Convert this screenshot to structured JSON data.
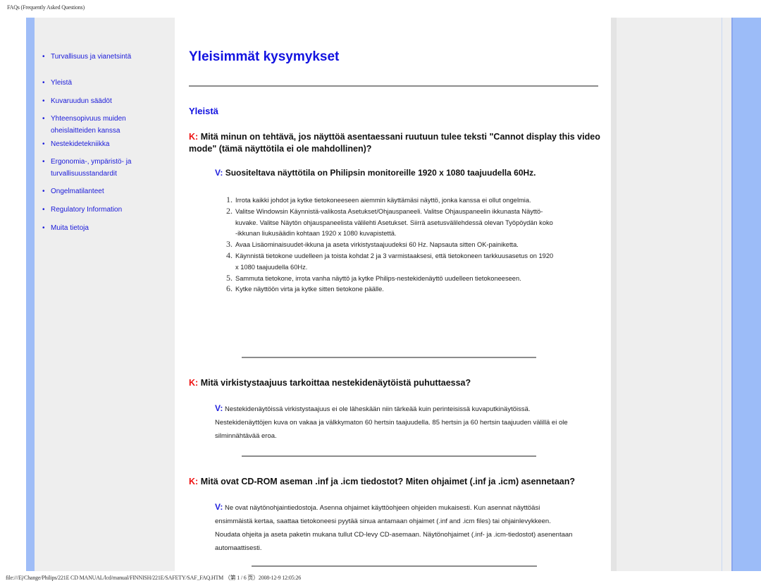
{
  "page_header": "FAQs (Frequently Asked Questions)",
  "page_footer": "file:///E|/Change/Philips/221E CD MANUAL/lcd/manual/FINNISH/221E/SAFETY/SAF_FAQ.HTM （第 1 / 6 页）2008-12-9 12:05:26",
  "sidebar": {
    "items": [
      {
        "label": "Turvallisuus ja vianetsintä"
      },
      {
        "label": "Yleistä"
      },
      {
        "label": "Kuvaruudun säädöt"
      },
      {
        "label": "Yhteensopivuus muiden oheislaitteiden kanssa"
      },
      {
        "label": "Nestekidetekniikka"
      },
      {
        "label": "Ergonomia-, ympäristö- ja turvallisuusstandardit"
      },
      {
        "label": "Ongelmatilanteet"
      },
      {
        "label": "Regulatory Information"
      },
      {
        "label": "Muita tietoja"
      }
    ],
    "bullet": "•"
  },
  "main": {
    "title": "Yleisimmät kysymykset",
    "section_title": "Yleistä",
    "q_prefix": "K:",
    "a_prefix": "V:",
    "faqs": [
      {
        "question": "Mitä minun on tehtävä, jos näyttöä asentaessani ruutuun tulee teksti \"Cannot display this video mode\" (tämä näyttötila ei ole mahdollinen)?",
        "answer_lead": "Suositeltava näyttötila on Philipsin monitoreille 1920 x 1080 taajuudella 60Hz.",
        "steps": [
          {
            "num": "1.",
            "text": "Irrota kaikki johdot ja kytke tietokoneeseen aiemmin käyttämäsi näyttö, jonka kanssa ei ollut ongelmia."
          },
          {
            "num": "2.",
            "text": "Valitse Windowsin Käynnistä-valikosta Asetukset/Ohjauspaneeli. Valitse Ohjauspaneelin ikkunasta Näyttö-kuvake. Valitse Näytön ohjauspaneelista välilehti Asetukset. Siirrä asetusvälilehdessä olevan Työpöydän koko -ikkunan liukusäädin kohtaan 1920 x 1080 kuvapistettä."
          },
          {
            "num": "3.",
            "text": "Avaa Lisäominaisuudet-ikkuna ja aseta virkistystaajuudeksi 60 Hz. Napsauta sitten OK-painiketta."
          },
          {
            "num": "4.",
            "text": "Käynnistä tietokone uudelleen ja toista kohdat 2 ja 3 varmistaaksesi, että tietokoneen tarkkuusasetus on 1920 x 1080 taajuudella 60Hz."
          },
          {
            "num": "5.",
            "text": "Sammuta tietokone, irrota vanha näyttö ja kytke Philips-nestekidenäyttö uudelleen tietokoneeseen."
          },
          {
            "num": "6.",
            "text": "Kytke näyttöön virta ja kytke sitten tietokone päälle."
          }
        ]
      },
      {
        "question": "Mitä virkistystaajuus tarkoittaa nestekidenäytöistä puhuttaessa?",
        "answer": "Nestekidenäytöissä virkistystaajuus ei ole läheskään niin tärkeää kuin perinteisissä kuvaputkinäytöissä. Nestekidenäyttöjen kuva on vakaa ja välkkymaton 60 hertsin taajuudella. 85 hertsin ja 60 hertsin taajuuden välillä ei ole silminnähtävää eroa."
      },
      {
        "question": "Mitä ovat CD-ROM aseman .inf ja .icm tiedostot? Miten ohjaimet (.inf ja .icm) asennetaan?",
        "answer": "Ne ovat näytönohjaintiedostoja. Asenna ohjaimet käyttöohjeen ohjeiden mukaisesti. Kun asennat näyttöäsi ensimmäistä kertaa, saattaa tietokoneesi pyytää sinua antamaan ohjaimet (.inf and .icm files) tai ohjainlevykkeen. Noudata ohjeita ja aseta paketin mukana tullut CD-levy CD-asemaan. Näytönohjaimet (.inf- ja .icm-tiedostot) asenentaan automaattisesti."
      }
    ]
  }
}
